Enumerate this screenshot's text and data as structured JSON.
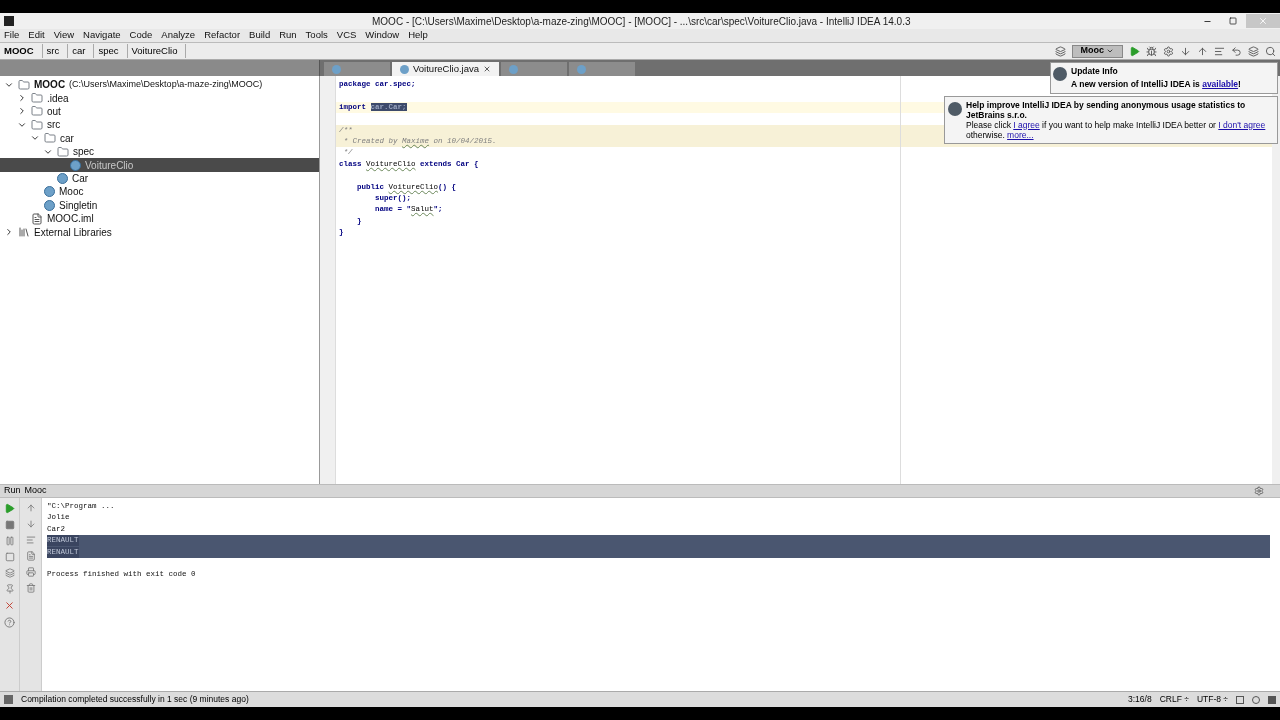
{
  "window": {
    "title": "MOOC - [C:\\Users\\Maxime\\Desktop\\a-maze-zing\\MOOC] - [MOOC] - ...\\src\\car\\spec\\VoitureClio.java - IntelliJ IDEA 14.0.3"
  },
  "menu": [
    "File",
    "Edit",
    "View",
    "Navigate",
    "Code",
    "Analyze",
    "Refactor",
    "Build",
    "Run",
    "Tools",
    "VCS",
    "Window",
    "Help"
  ],
  "breadcrumbs": [
    "MOOC",
    "src",
    "car",
    "spec",
    "VoitureClio"
  ],
  "run_config": "Mooc",
  "tabs": [
    {
      "selected": false
    },
    {
      "label": "VoitureClio.java",
      "selected": true
    },
    {
      "selected": false
    },
    {
      "selected": false
    }
  ],
  "tree": [
    {
      "label": "MOOC",
      "path": "(C:\\Users\\Maxime\\Desktop\\a-maze-zing\\MOOC)",
      "kind": "module",
      "expanded": true,
      "selected": false,
      "children": [
        {
          "label": ".idea",
          "kind": "folder",
          "expanded": false,
          "selected": false
        },
        {
          "label": "out",
          "kind": "folder",
          "expanded": false,
          "selected": false
        },
        {
          "label": "src",
          "kind": "folder",
          "expanded": true,
          "selected": false,
          "children": [
            {
              "label": "car",
              "kind": "package",
              "expanded": true,
              "selected": false,
              "children": [
                {
                  "label": "spec",
                  "kind": "package",
                  "expanded": true,
                  "selected": false,
                  "children": [
                    {
                      "label": "VoitureClio",
                      "kind": "class",
                      "selected": true
                    }
                  ]
                },
                {
                  "label": "Car",
                  "kind": "class",
                  "selected": false
                }
              ]
            },
            {
              "label": "Mooc",
              "kind": "class",
              "selected": false
            },
            {
              "label": "Singletin",
              "kind": "class",
              "selected": false
            }
          ]
        },
        {
          "label": "MOOC.iml",
          "kind": "file",
          "selected": false
        }
      ]
    },
    {
      "label": "External Libraries",
      "kind": "library",
      "expanded": false,
      "selected": false
    }
  ],
  "code": [
    {
      "kind": "plain",
      "segments": [
        {
          "text": "package car.spec;",
          "kind": "plain"
        }
      ]
    },
    {
      "kind": "plain"
    },
    {
      "kind": "current",
      "segments": [
        {
          "text": "import ",
          "kind": "plain"
        },
        {
          "text": "car.Car;",
          "kind": "sel"
        }
      ]
    },
    {
      "kind": "plain"
    },
    {
      "kind": "doc",
      "segments": [
        {
          "text": "/**",
          "kind": "comment"
        }
      ]
    },
    {
      "kind": "doc",
      "segments": [
        {
          "text": " * Created by ",
          "kind": "comment"
        },
        {
          "text": "Maxime",
          "kind": "commentwarn"
        },
        {
          "text": " on 10/04/2015.",
          "kind": "comment"
        }
      ]
    },
    {
      "kind": "plain",
      "segments": [
        {
          "text": " */",
          "kind": "comment"
        }
      ]
    },
    {
      "kind": "plain",
      "segments": [
        {
          "text": "class ",
          "kind": "plain"
        },
        {
          "text": "VoitureClio",
          "kind": "warn"
        },
        {
          "text": " extends Car {",
          "kind": "plain"
        }
      ]
    },
    {
      "kind": "plain"
    },
    {
      "kind": "plain",
      "segments": [
        {
          "text": "    public ",
          "kind": "plain"
        },
        {
          "text": "VoitureClio",
          "kind": "warn"
        },
        {
          "text": "() {",
          "kind": "plain"
        }
      ]
    },
    {
      "kind": "plain",
      "segments": [
        {
          "text": "        super();",
          "kind": "plain"
        }
      ]
    },
    {
      "kind": "plain",
      "segments": [
        {
          "text": "        name = \"",
          "kind": "plain"
        },
        {
          "text": "Salut",
          "kind": "warn"
        },
        {
          "text": "\";",
          "kind": "plain"
        }
      ]
    },
    {
      "kind": "plain",
      "segments": [
        {
          "text": "    }",
          "kind": "plain"
        }
      ]
    },
    {
      "kind": "plain",
      "segments": [
        {
          "text": "}",
          "kind": "plain"
        }
      ]
    }
  ],
  "notifications": [
    {
      "title": "Update Info",
      "text": "A new version of IntelliJ IDEA is ",
      "link": "available",
      "after": "!"
    },
    {
      "title": "Help improve IntelliJ IDEA by sending anonymous usage statistics to JetBrains s.r.o.",
      "text": "Please click ",
      "link": "I agree",
      "after": " if you want to help make IntelliJ IDEA better or ",
      "link2": "I don't agree",
      "after2": " otherwise. ",
      "link3": "more..."
    }
  ],
  "run_panel": {
    "label": "Run",
    "config": "Mooc",
    "output": [
      {
        "text": "\"C:\\Program ...",
        "selected": false
      },
      {
        "text": "Jolie",
        "selected": false
      },
      {
        "text": "Car2",
        "selected": false
      },
      {
        "text": "RENAULT",
        "selected": true
      },
      {
        "text": "RENAULT",
        "selected": true
      },
      {
        "selected": false
      },
      {
        "text": "Process finished with exit code 0",
        "selected": false
      }
    ]
  },
  "status_bar": {
    "message": "Compilation completed successfully in 1 sec (9 minutes ago)",
    "position": "3:16/8",
    "line_sep": "CRLF ÷",
    "encoding": "UTF-8 ÷"
  }
}
